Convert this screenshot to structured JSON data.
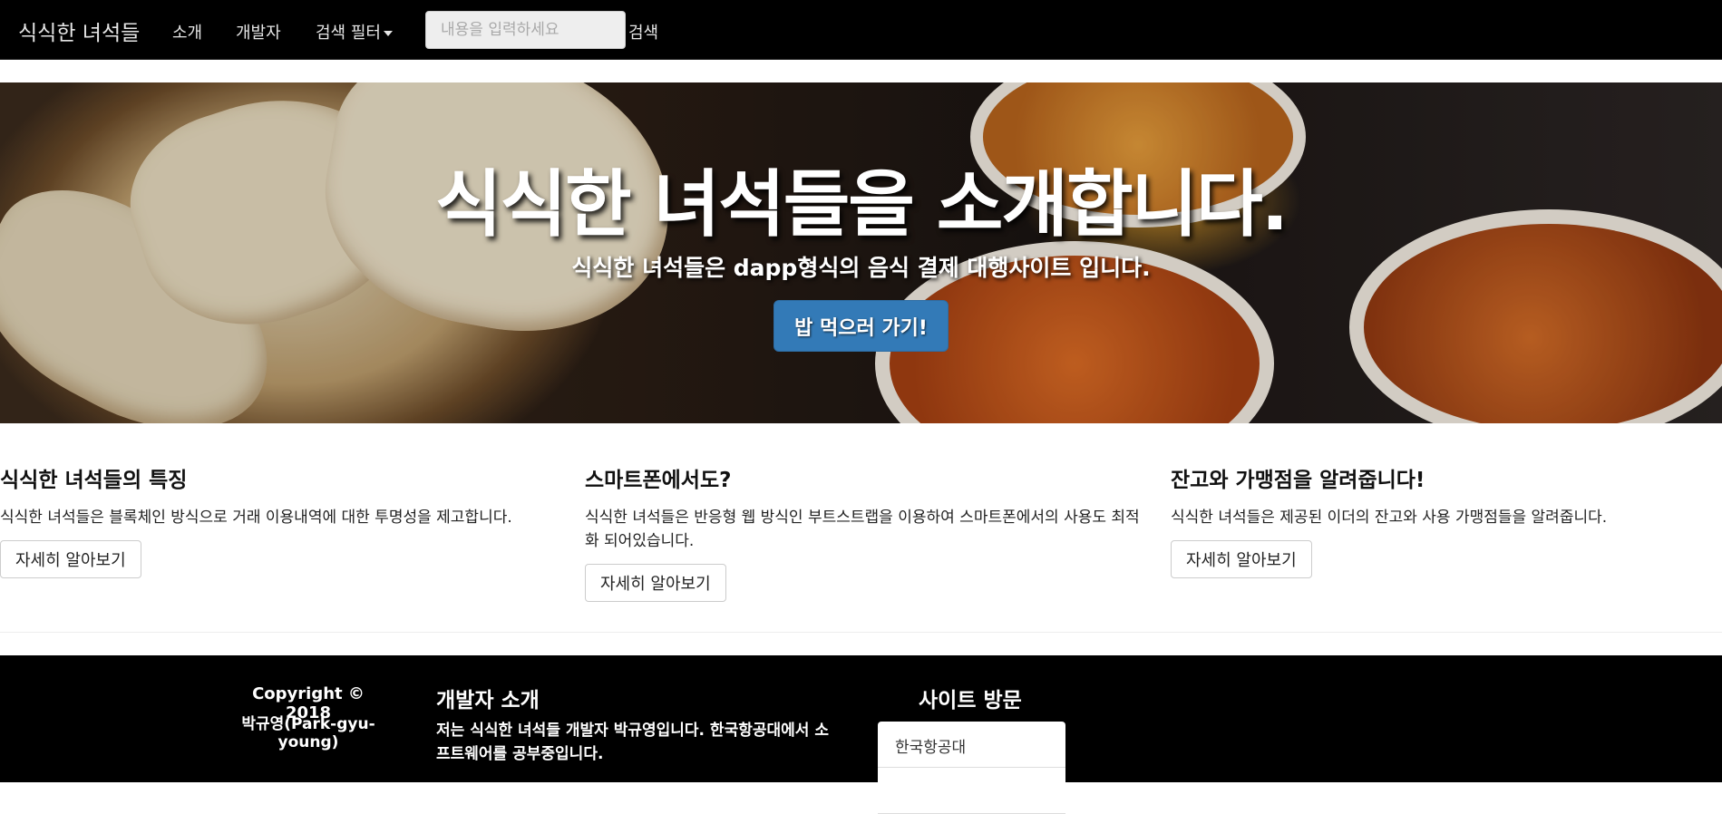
{
  "navbar": {
    "brand": "식식한 녀석들",
    "items": [
      {
        "label": "소개"
      },
      {
        "label": "개발자"
      },
      {
        "label": "검색 필터"
      }
    ],
    "search": {
      "placeholder": "내용을 입력하세요",
      "value": "",
      "button_label": "검색"
    }
  },
  "hero": {
    "title": "식식한 녀석들을 소개합니다.",
    "subtitle": "식식한 녀석들은 dapp형식의 음식 결제 대행사이트 입니다.",
    "button_label": "밥 먹으러 가기!"
  },
  "features": [
    {
      "title": "식식한 녀석들의 특징",
      "text": "식식한 녀석들은 블록체인 방식으로 거래 이용내역에 대한 투명성을 제고합니다.",
      "button_label": "자세히 알아보기"
    },
    {
      "title": "스마트폰에서도?",
      "text": "식식한 녀석들은 반응형 웹 방식인 부트스트랩을 이용하여 스마트폰에서의 사용도 최적화 되어있습니다.",
      "button_label": "자세히 알아보기"
    },
    {
      "title": "잔고와 가맹점을 알려줍니다!",
      "text": "식식한 녀석들은 제공된 이더의 잔고와 사용 가맹점들을 알려줍니다.",
      "button_label": "자세히 알아보기"
    }
  ],
  "footer": {
    "copyright": "Copyright © 2018",
    "author": "박규영(Park-gyu-young)",
    "dev_title": "개발자 소개",
    "dev_text": "저는 식식한 녀석들 개발자 박규영입니다. 한국항공대에서 소프트웨어를 공부중입니다.",
    "visit_title": "사이트 방문",
    "visit_items": [
      {
        "label": "한국항공대"
      },
      {
        "label": ""
      }
    ]
  },
  "colors": {
    "navbar_bg": "#000000",
    "primary_button": "#337ab7",
    "footer_bg": "#000000"
  }
}
